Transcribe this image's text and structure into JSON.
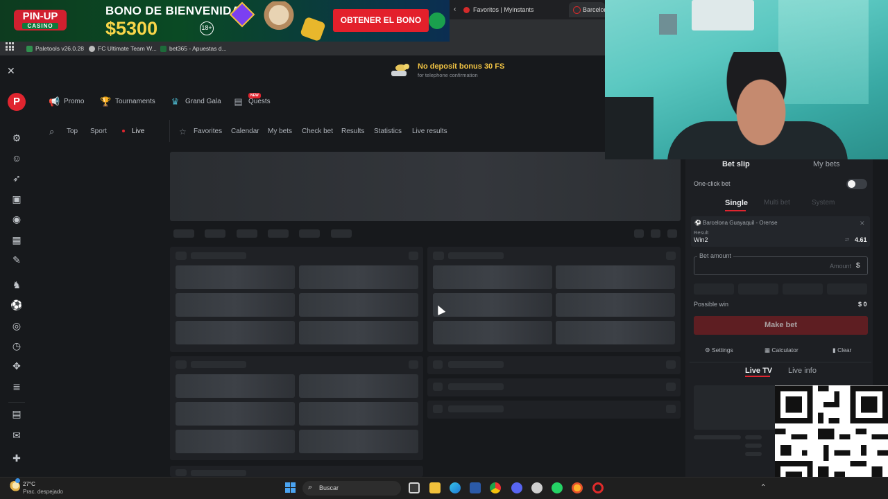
{
  "banner": {
    "logo_main": "PIN-UP",
    "logo_sub": "CASINO",
    "headline": "BONO DE BIENVENIDA",
    "amount": "$5300",
    "age": "18+",
    "cta": "OBTENER EL BONO"
  },
  "browser": {
    "tabs": [
      {
        "label": "Favoritos | Myinstants"
      },
      {
        "label": "Barcelon"
      }
    ],
    "bookmarks": [
      {
        "label": "Paletools v26.0.28",
        "color": "#2f8f4e"
      },
      {
        "label": "FC Ultimate Team W...",
        "color": "#bdbdbd"
      },
      {
        "label": "bet365 - Apuestas d...",
        "color": "#1d6b3a"
      }
    ]
  },
  "notification": {
    "title": "No deposit bonus 30 FS",
    "subtitle": "for telephone confirmation"
  },
  "topnav": [
    {
      "label": "Promo",
      "icon": "megaphone-icon"
    },
    {
      "label": "Tournaments",
      "icon": "trophy-icon"
    },
    {
      "label": "Grand Gala",
      "icon": "gala-icon"
    },
    {
      "label": "Quests",
      "icon": "quest-icon",
      "badge": "NEW"
    }
  ],
  "subnav": {
    "search_icon": "search-icon",
    "items": [
      "Top",
      "Sport",
      "Live"
    ],
    "links": [
      "Favorites",
      "Calendar",
      "My bets",
      "Check bet",
      "Results",
      "Statistics",
      "Live results"
    ]
  },
  "sidebar_icons": [
    "settings-icon",
    "user-icon",
    "rocket-icon",
    "tv-icon",
    "balloon-icon",
    "casino-icon",
    "ticket-icon",
    "fighter-icon",
    "soccer-icon",
    "target-icon",
    "clock-icon",
    "gamepad-icon",
    "list-icon",
    "contact-card-icon",
    "chat-icon",
    "flag-uk-icon"
  ],
  "betslip": {
    "tabs": [
      "Bet slip",
      "My bets"
    ],
    "one_click_label": "One-click bet",
    "modes": [
      "Single",
      "Multi bet",
      "System"
    ],
    "selection": {
      "match": "Barcelona Guayaquil - Orense",
      "market": "Result",
      "outcome": "Win2",
      "odds": "4.61"
    },
    "amount_label": "Bet amount",
    "amount_placeholder": "Amount",
    "currency": "$",
    "possible_win_label": "Possible win",
    "possible_win_value": "$ 0",
    "make_bet": "Make bet",
    "footer": [
      "Settings",
      "Calculator",
      "Clear"
    ],
    "media_tabs": [
      "Live TV",
      "Live info"
    ]
  },
  "taskbar": {
    "temperature": "27°C",
    "weather": "Prac. despejado",
    "search_label": "Buscar"
  },
  "colors": {
    "accent": "#e0252f",
    "background": "#17191c",
    "promo_gold": "#f3c544"
  }
}
